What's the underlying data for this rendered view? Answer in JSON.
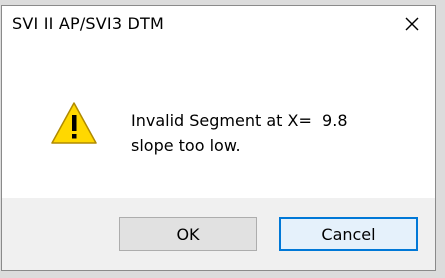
{
  "dialog": {
    "title": "SVI II AP/SVI3 DTM",
    "close_label": "✕",
    "icon": "warning-icon",
    "message_line1": "Invalid Segment at X=  9.8",
    "message_line2": "slope too low.",
    "ok_label": "OK",
    "cancel_label": "Cancel"
  },
  "colors": {
    "warning_fill": "#ffd800",
    "default_button_border": "#0078d7",
    "footer_bg": "#f0f0f0"
  }
}
